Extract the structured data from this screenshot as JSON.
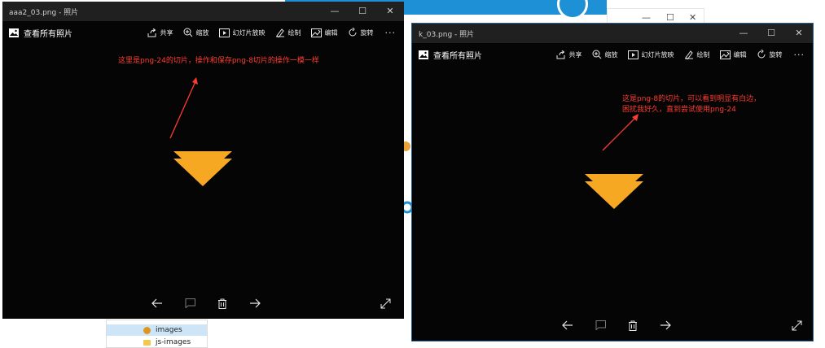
{
  "background": {
    "explorer_items": [
      {
        "label": "images",
        "selected": true
      },
      {
        "label": "js-images",
        "selected": false
      }
    ]
  },
  "left_window": {
    "title": "aaa2_03.png - 照片",
    "toolbar": {
      "view_all": "查看所有照片",
      "items": [
        {
          "label": "共享",
          "icon": "share-icon"
        },
        {
          "label": "缩放",
          "icon": "zoom-icon"
        },
        {
          "label": "幻灯片放映",
          "icon": "slideshow-icon"
        },
        {
          "label": "绘制",
          "icon": "draw-icon"
        },
        {
          "label": "编辑",
          "icon": "edit-icon"
        },
        {
          "label": "旋转",
          "icon": "rotate-icon"
        }
      ],
      "more": "···"
    },
    "annotation": "这里是png-24的切片，操作和保存png-8切片的操作一模一样"
  },
  "right_window": {
    "title": "k_03.png - 照片",
    "toolbar": {
      "view_all": "查看所有照片",
      "items": [
        {
          "label": "共享",
          "icon": "share-icon"
        },
        {
          "label": "缩放",
          "icon": "zoom-icon"
        },
        {
          "label": "幻灯片放映",
          "icon": "slideshow-icon"
        },
        {
          "label": "绘制",
          "icon": "draw-icon"
        },
        {
          "label": "编辑",
          "icon": "edit-icon"
        },
        {
          "label": "旋转",
          "icon": "rotate-icon"
        }
      ],
      "more": "···"
    },
    "annotation_line1": "这是png-8的切片，可以看到明显有白边，",
    "annotation_line2": "困扰我好久，直到尝试使用png-24"
  },
  "colors": {
    "arrow_orange": "#f7a823",
    "annotation_red": "#ff3b30",
    "window_black": "#050505"
  }
}
